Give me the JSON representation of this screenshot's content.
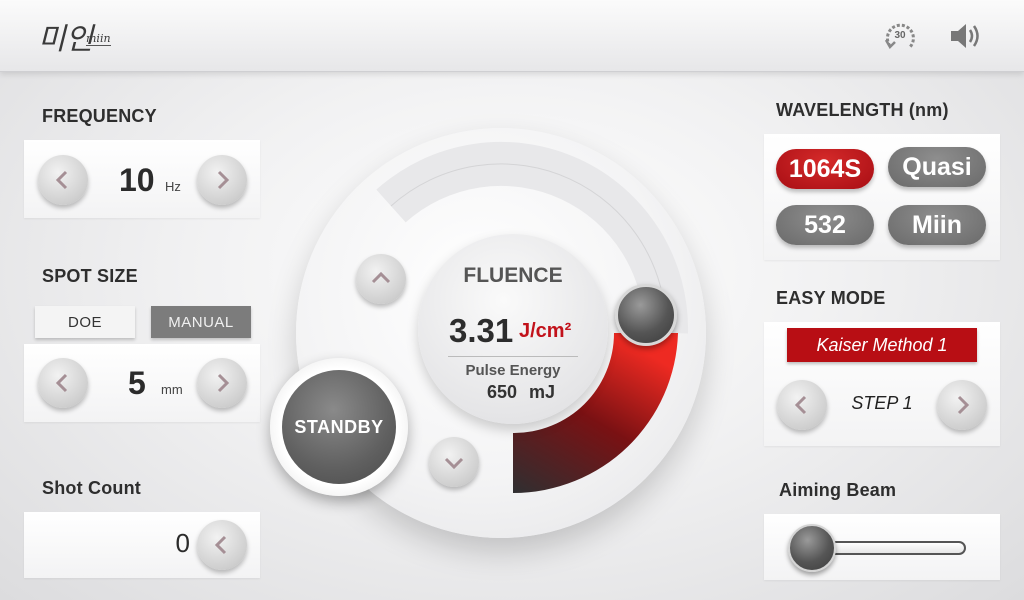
{
  "header": {
    "logo_text": "미인",
    "logo_subtext": "miin",
    "timer_value": "30"
  },
  "frequency": {
    "title": "FREQUENCY",
    "value": "10",
    "unit": "Hz"
  },
  "spot_size": {
    "title": "SPOT SIZE",
    "mode_doe": "DOE",
    "mode_manual": "MANUAL",
    "value": "5",
    "unit": "mm"
  },
  "shot_count": {
    "title": "Shot Count",
    "value": "0"
  },
  "fluence": {
    "label": "FLUENCE",
    "value": "3.31",
    "unit": "J/cm²",
    "pulse_label": "Pulse Energy",
    "pulse_value": "650",
    "pulse_unit": "mJ",
    "standby_label": "STANDBY",
    "accent_color": "#c2121b"
  },
  "wavelength": {
    "title": "WAVELENGTH (nm)",
    "options": [
      "1064S",
      "Quasi",
      "532",
      "Miin"
    ],
    "selected": "1064S",
    "active_color": "#b80e14",
    "idle_color": "#7c7c7c"
  },
  "easy_mode": {
    "title": "EASY MODE",
    "method": "Kaiser Method 1",
    "step": "STEP 1"
  },
  "aiming_beam": {
    "title": "Aiming Beam",
    "level": 0
  }
}
